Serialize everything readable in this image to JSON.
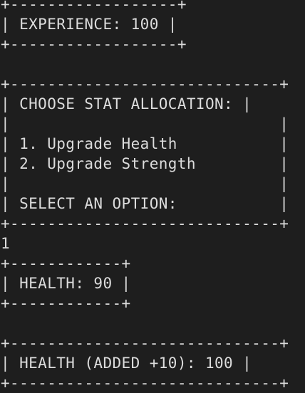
{
  "terminal": {
    "lines": [
      "+------------------+",
      "| EXPERIENCE: 100 |",
      "+------------------+",
      "",
      "+-----------------------------+",
      "| CHOOSE STAT ALLOCATION: |",
      "|                             |",
      "| 1. Upgrade Health           |",
      "| 2. Upgrade Strength         |",
      "|                             |",
      "| SELECT AN OPTION:           |",
      "+-----------------------------+",
      "1",
      "+------------+",
      "| HEALTH: 90 |",
      "+------------+",
      "",
      "+-----------------------------+",
      "| HEALTH (ADDED +10): 100 |",
      "+-----------------------------+"
    ]
  }
}
